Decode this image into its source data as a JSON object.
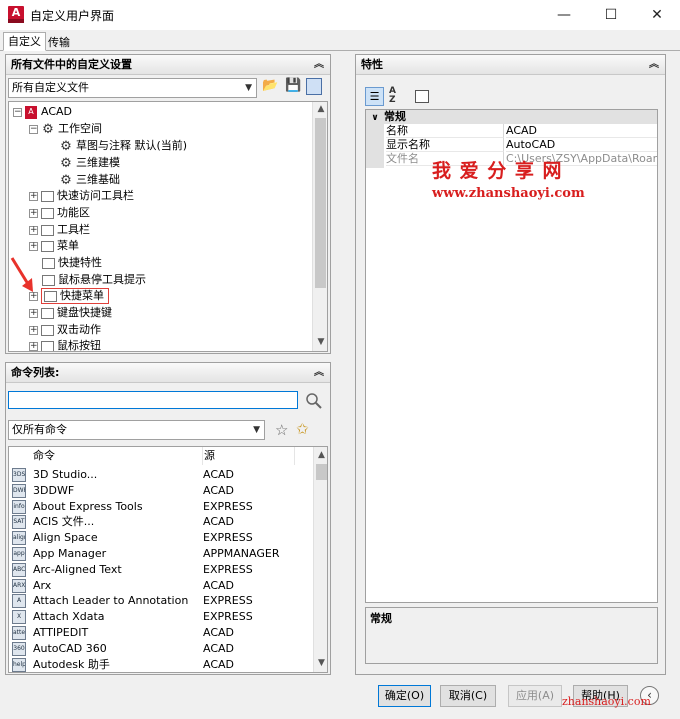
{
  "window": {
    "title": "自定义用户界面",
    "app_icon_letter": "A",
    "minimize": "—",
    "maximize": "☐",
    "close": "✕"
  },
  "tabs": [
    "自定义",
    "传输"
  ],
  "left_top": {
    "header": "所有文件中的自定义设置",
    "combo": "所有自定义文件",
    "tree": {
      "root": "ACAD",
      "workspace": "工作空间",
      "workspace_items": [
        "草图与注释 默认(当前)",
        "三维建模",
        "三维基础"
      ],
      "items": [
        "快速访问工具栏",
        "功能区",
        "工具栏",
        "菜单",
        "快捷特性",
        "鼠标悬停工具提示",
        "快捷菜单",
        "键盘快捷键",
        "双击动作",
        "鼠标按钮"
      ]
    }
  },
  "commands": {
    "header": "命令列表:",
    "search_value": "",
    "filter": "仅所有命令",
    "columns": [
      "命令",
      "源"
    ],
    "rows": [
      {
        "name": "3D Studio...",
        "src": "ACAD",
        "icon": "3DS"
      },
      {
        "name": "3DDWF",
        "src": "ACAD",
        "icon": "DWF"
      },
      {
        "name": "About Express Tools",
        "src": "EXPRESS",
        "icon": "info"
      },
      {
        "name": "ACIS 文件...",
        "src": "ACAD",
        "icon": "SAT"
      },
      {
        "name": "Align Space",
        "src": "EXPRESS",
        "icon": "align"
      },
      {
        "name": "App Manager",
        "src": "APPMANAGER",
        "icon": "app"
      },
      {
        "name": "Arc-Aligned Text",
        "src": "EXPRESS",
        "icon": "ABC"
      },
      {
        "name": "Arx",
        "src": "ACAD",
        "icon": "ARX"
      },
      {
        "name": "Attach Leader to Annotation",
        "src": "EXPRESS",
        "icon": "A"
      },
      {
        "name": "Attach Xdata",
        "src": "EXPRESS",
        "icon": "X"
      },
      {
        "name": "ATTIPEDIT",
        "src": "ACAD",
        "icon": "attedit"
      },
      {
        "name": "AutoCAD 360",
        "src": "ACAD",
        "icon": "360"
      },
      {
        "name": "Autodesk 助手",
        "src": "ACAD",
        "icon": "help"
      }
    ]
  },
  "properties": {
    "header": "特性",
    "category": "常规",
    "rows": [
      {
        "label": "名称",
        "value": "ACAD"
      },
      {
        "label": "显示名称",
        "value": "AutoCAD"
      },
      {
        "label": "文件名",
        "value": "C:\\Users\\ZSY\\AppData\\Roaming"
      }
    ],
    "desc_title": "常规"
  },
  "watermark": {
    "title": "我 爱 分 享 网",
    "url": "www.zhanshaoyi.com",
    "corner": "zhanshaoyi.com"
  },
  "buttons": {
    "ok": "确定(O)",
    "cancel": "取消(C)",
    "apply": "应用(A)",
    "help": "帮助(H)"
  }
}
